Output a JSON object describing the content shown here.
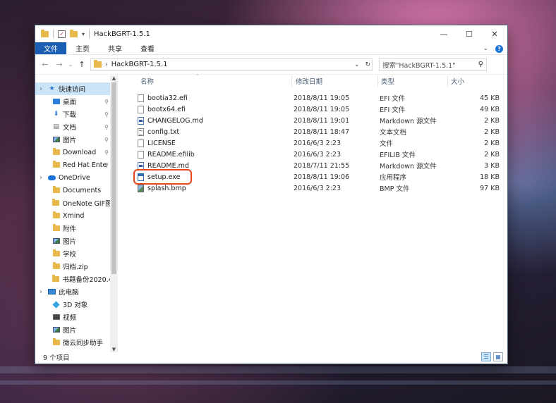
{
  "window": {
    "title": "HackBGRT-1.5.1",
    "controls": [
      "—",
      "☐",
      "✕"
    ]
  },
  "ribbon": {
    "file_tab": "文件",
    "tabs": [
      "主页",
      "共享",
      "查看"
    ]
  },
  "address": {
    "path": "HackBGRT-1.5.1",
    "search_placeholder": "搜索\"HackBGRT-1.5.1\""
  },
  "columns": {
    "name": "名称",
    "date": "修改日期",
    "type": "类型",
    "size": "大小"
  },
  "navigation": [
    {
      "label": "快速访问",
      "icon": "star-icon",
      "pinned": false
    },
    {
      "label": "桌面",
      "icon": "desktop-icon",
      "pinned": true
    },
    {
      "label": "下载",
      "icon": "download-icon",
      "pinned": true
    },
    {
      "label": "文档",
      "icon": "documents-icon",
      "pinned": true
    },
    {
      "label": "图片",
      "icon": "pictures-icon",
      "pinned": true
    },
    {
      "label": "Download",
      "icon": "folder-icon",
      "pinned": true
    },
    {
      "label": "Red Hat Ente",
      "icon": "folder-icon",
      "pinned": true
    },
    {
      "label": "OneDrive",
      "icon": "cloud-icon",
      "pinned": false
    },
    {
      "label": "Documents",
      "icon": "folder-icon",
      "pinned": false
    },
    {
      "label": "OneNote GIF图",
      "icon": "folder-icon",
      "pinned": false
    },
    {
      "label": "Xmind",
      "icon": "folder-icon",
      "pinned": false
    },
    {
      "label": "附件",
      "icon": "folder-icon",
      "pinned": false
    },
    {
      "label": "图片",
      "icon": "pictures-icon",
      "pinned": false
    },
    {
      "label": "学校",
      "icon": "folder-icon",
      "pinned": false
    },
    {
      "label": "归档.zip",
      "icon": "zip-icon",
      "pinned": false
    },
    {
      "label": "书籍备份2020.4",
      "icon": "zip-icon",
      "pinned": false
    },
    {
      "label": "此电脑",
      "icon": "computer-icon",
      "pinned": false
    },
    {
      "label": "3D 对象",
      "icon": "3d-objects-icon",
      "pinned": false
    },
    {
      "label": "视频",
      "icon": "video-icon",
      "pinned": false
    },
    {
      "label": "图片",
      "icon": "pictures-icon",
      "pinned": false
    },
    {
      "label": "微云同步助手",
      "icon": "folder-icon",
      "pinned": false
    }
  ],
  "files": [
    {
      "name": "bootia32.efi",
      "date": "2018/8/11 19:05",
      "type": "EFI 文件",
      "size": "45 KB",
      "icon": "file-icon"
    },
    {
      "name": "bootx64.efi",
      "date": "2018/8/11 19:05",
      "type": "EFI 文件",
      "size": "49 KB",
      "icon": "file-icon"
    },
    {
      "name": "CHANGELOG.md",
      "date": "2018/8/11 19:01",
      "type": "Markdown 源文件",
      "size": "2 KB",
      "icon": "markdown-file-icon"
    },
    {
      "name": "config.txt",
      "date": "2018/8/11 18:47",
      "type": "文本文档",
      "size": "2 KB",
      "icon": "text-file-icon"
    },
    {
      "name": "LICENSE",
      "date": "2016/6/3 2:23",
      "type": "文件",
      "size": "2 KB",
      "icon": "file-icon"
    },
    {
      "name": "README.efilib",
      "date": "2016/6/3 2:23",
      "type": "EFILIB 文件",
      "size": "2 KB",
      "icon": "file-icon"
    },
    {
      "name": "README.md",
      "date": "2018/7/11 21:55",
      "type": "Markdown 源文件",
      "size": "3 KB",
      "icon": "markdown-file-icon"
    },
    {
      "name": "setup.exe",
      "date": "2018/8/11 19:06",
      "type": "应用程序",
      "size": "18 KB",
      "icon": "exe-file-icon"
    },
    {
      "name": "splash.bmp",
      "date": "2016/6/3 2:23",
      "type": "BMP 文件",
      "size": "97 KB",
      "icon": "bmp-file-icon"
    }
  ],
  "highlighted_file": "setup.exe",
  "highlight_color": "#e5461e",
  "accent_color": "#1a5fb4",
  "status": {
    "item_count": "9 个项目"
  }
}
